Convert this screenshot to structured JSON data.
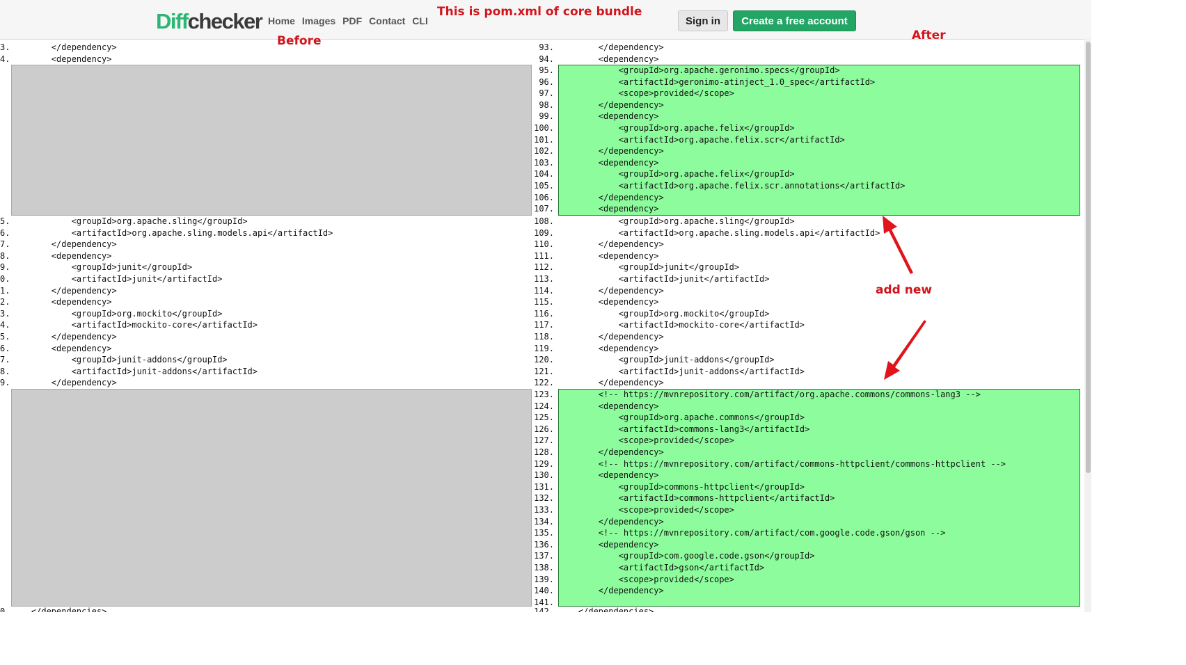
{
  "header": {
    "logo_part1": "Diff",
    "logo_part2": "checker",
    "nav": [
      "Home",
      "Images",
      "PDF",
      "Contact",
      "CLI"
    ],
    "sign_in": "Sign in",
    "create_account": "Create a free account"
  },
  "annotations": {
    "title": "This is pom.xml of core bundle",
    "before": "Before",
    "after": "After",
    "add_new": "add new"
  },
  "colors": {
    "added": "#8cfc9c",
    "removed_placeholder": "#cccccc",
    "annotation": "#d0151c",
    "brand": "#2cb673"
  },
  "left": {
    "top_lines": [
      {
        "n": "3.",
        "t": "        </dependency>"
      },
      {
        "n": "4.",
        "t": "        <dependency>"
      }
    ],
    "mid_lines": [
      {
        "n": "5.",
        "t": "            <groupId>org.apache.sling</groupId>"
      },
      {
        "n": "6.",
        "t": "            <artifactId>org.apache.sling.models.api</artifactId>"
      },
      {
        "n": "7.",
        "t": "        </dependency>"
      },
      {
        "n": "8.",
        "t": "        <dependency>"
      },
      {
        "n": "9.",
        "t": "            <groupId>junit</groupId>"
      },
      {
        "n": "0.",
        "t": "            <artifactId>junit</artifactId>"
      },
      {
        "n": "1.",
        "t": "        </dependency>"
      },
      {
        "n": "2.",
        "t": "        <dependency>"
      },
      {
        "n": "3.",
        "t": "            <groupId>org.mockito</groupId>"
      },
      {
        "n": "4.",
        "t": "            <artifactId>mockito-core</artifactId>"
      },
      {
        "n": "5.",
        "t": "        </dependency>"
      },
      {
        "n": "6.",
        "t": "        <dependency>"
      },
      {
        "n": "7.",
        "t": "            <groupId>junit-addons</groupId>"
      },
      {
        "n": "8.",
        "t": "            <artifactId>junit-addons</artifactId>"
      },
      {
        "n": "9.",
        "t": "        </dependency>"
      }
    ],
    "bottom_lines": [
      {
        "n": "0.",
        "t": "    </dependencies>"
      }
    ]
  },
  "right": {
    "top_lines": [
      {
        "n": "93.",
        "t": "        </dependency>"
      },
      {
        "n": "94.",
        "t": "        <dependency>"
      }
    ],
    "added_block_1": [
      {
        "n": "95.",
        "t": "            <groupId>org.apache.geronimo.specs</groupId>"
      },
      {
        "n": "96.",
        "t": "            <artifactId>geronimo-atinject_1.0_spec</artifactId>"
      },
      {
        "n": "97.",
        "t": "            <scope>provided</scope>"
      },
      {
        "n": "98.",
        "t": "        </dependency>"
      },
      {
        "n": "99.",
        "t": "        <dependency>"
      },
      {
        "n": "100.",
        "t": "            <groupId>org.apache.felix</groupId>"
      },
      {
        "n": "101.",
        "t": "            <artifactId>org.apache.felix.scr</artifactId>"
      },
      {
        "n": "102.",
        "t": "        </dependency>"
      },
      {
        "n": "103.",
        "t": "        <dependency>"
      },
      {
        "n": "104.",
        "t": "            <groupId>org.apache.felix</groupId>"
      },
      {
        "n": "105.",
        "t": "            <artifactId>org.apache.felix.scr.annotations</artifactId>"
      },
      {
        "n": "106.",
        "t": "        </dependency>"
      },
      {
        "n": "107.",
        "t": "        <dependency>"
      }
    ],
    "mid_lines": [
      {
        "n": "108.",
        "t": "            <groupId>org.apache.sling</groupId>"
      },
      {
        "n": "109.",
        "t": "            <artifactId>org.apache.sling.models.api</artifactId>"
      },
      {
        "n": "110.",
        "t": "        </dependency>"
      },
      {
        "n": "111.",
        "t": "        <dependency>"
      },
      {
        "n": "112.",
        "t": "            <groupId>junit</groupId>"
      },
      {
        "n": "113.",
        "t": "            <artifactId>junit</artifactId>"
      },
      {
        "n": "114.",
        "t": "        </dependency>"
      },
      {
        "n": "115.",
        "t": "        <dependency>"
      },
      {
        "n": "116.",
        "t": "            <groupId>org.mockito</groupId>"
      },
      {
        "n": "117.",
        "t": "            <artifactId>mockito-core</artifactId>"
      },
      {
        "n": "118.",
        "t": "        </dependency>"
      },
      {
        "n": "119.",
        "t": "        <dependency>"
      },
      {
        "n": "120.",
        "t": "            <groupId>junit-addons</groupId>"
      },
      {
        "n": "121.",
        "t": "            <artifactId>junit-addons</artifactId>"
      },
      {
        "n": "122.",
        "t": "        </dependency>"
      }
    ],
    "added_block_2": [
      {
        "n": "123.",
        "t": "        <!-- https://mvnrepository.com/artifact/org.apache.commons/commons-lang3 -->"
      },
      {
        "n": "124.",
        "t": "        <dependency>"
      },
      {
        "n": "125.",
        "t": "            <groupId>org.apache.commons</groupId>"
      },
      {
        "n": "126.",
        "t": "            <artifactId>commons-lang3</artifactId>"
      },
      {
        "n": "127.",
        "t": "            <scope>provided</scope>"
      },
      {
        "n": "128.",
        "t": "        </dependency>"
      },
      {
        "n": "129.",
        "t": "        <!-- https://mvnrepository.com/artifact/commons-httpclient/commons-httpclient -->"
      },
      {
        "n": "130.",
        "t": "        <dependency>"
      },
      {
        "n": "131.",
        "t": "            <groupId>commons-httpclient</groupId>"
      },
      {
        "n": "132.",
        "t": "            <artifactId>commons-httpclient</artifactId>"
      },
      {
        "n": "133.",
        "t": "            <scope>provided</scope>"
      },
      {
        "n": "134.",
        "t": "        </dependency>"
      },
      {
        "n": "135.",
        "t": "        <!-- https://mvnrepository.com/artifact/com.google.code.gson/gson -->"
      },
      {
        "n": "136.",
        "t": "        <dependency>"
      },
      {
        "n": "137.",
        "t": "            <groupId>com.google.code.gson</groupId>"
      },
      {
        "n": "138.",
        "t": "            <artifactId>gson</artifactId>"
      },
      {
        "n": "139.",
        "t": "            <scope>provided</scope>"
      },
      {
        "n": "140.",
        "t": "        </dependency>"
      },
      {
        "n": "141.",
        "t": ""
      }
    ],
    "bottom_lines": [
      {
        "n": "142.",
        "t": "    </dependencies>"
      }
    ]
  }
}
